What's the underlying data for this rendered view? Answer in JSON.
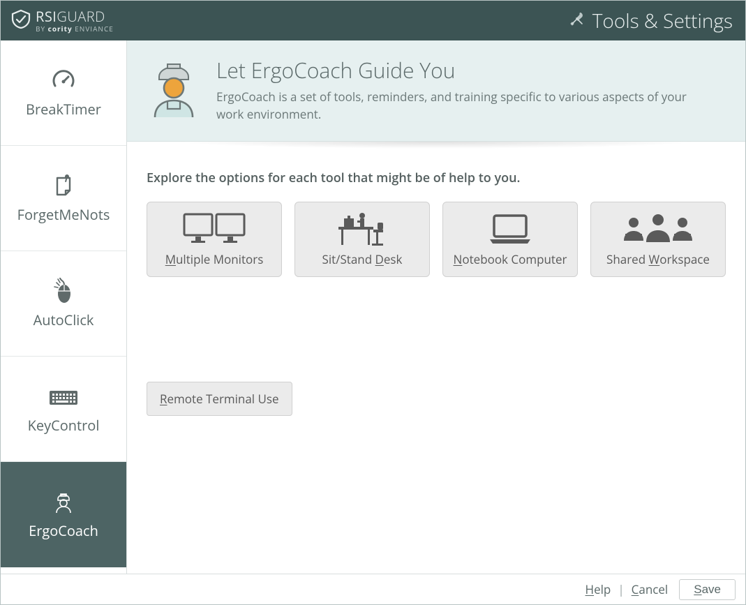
{
  "header": {
    "brand_main": "RSIGUARD",
    "brand_by": "BY",
    "brand_company": "cority",
    "brand_suffix": "ENVIANCE",
    "title": "Tools & Settings",
    "tools_icon": "tools-icon"
  },
  "sidebar": {
    "items": [
      {
        "label": "BreakTimer",
        "icon": "gauge-icon",
        "active": false
      },
      {
        "label": "ForgetMeNots",
        "icon": "note-icon",
        "active": false
      },
      {
        "label": "AutoClick",
        "icon": "mouse-icon",
        "active": false
      },
      {
        "label": "KeyControl",
        "icon": "keyboard-icon",
        "active": false
      },
      {
        "label": "ErgoCoach",
        "icon": "coach-icon",
        "active": true
      }
    ]
  },
  "hero": {
    "title": "Let ErgoCoach Guide You",
    "description": "ErgoCoach is a set of tools, reminders, and training specific to various aspects of your work environment."
  },
  "content": {
    "explore_label": "Explore the options for each tool that might be of help to you.",
    "tools": [
      {
        "label_pre": "",
        "label_accel": "M",
        "label_post": "ultiple Monitors",
        "icon": "multiple-monitors-icon"
      },
      {
        "label_pre": "Sit/Stand ",
        "label_accel": "D",
        "label_post": "esk",
        "icon": "sit-stand-desk-icon"
      },
      {
        "label_pre": "",
        "label_accel": "N",
        "label_post": "otebook Computer",
        "icon": "notebook-icon"
      },
      {
        "label_pre": "Shared ",
        "label_accel": "W",
        "label_post": "orkspace",
        "icon": "shared-workspace-icon"
      }
    ],
    "remote": {
      "label_pre": "",
      "label_accel": "R",
      "label_post": "emote Terminal Use"
    }
  },
  "footer": {
    "help_pre": "",
    "help_accel": "H",
    "help_post": "elp",
    "cancel_pre": "",
    "cancel_accel": "C",
    "cancel_post": "ancel",
    "save_pre": "",
    "save_accel": "S",
    "save_post": "ave"
  }
}
